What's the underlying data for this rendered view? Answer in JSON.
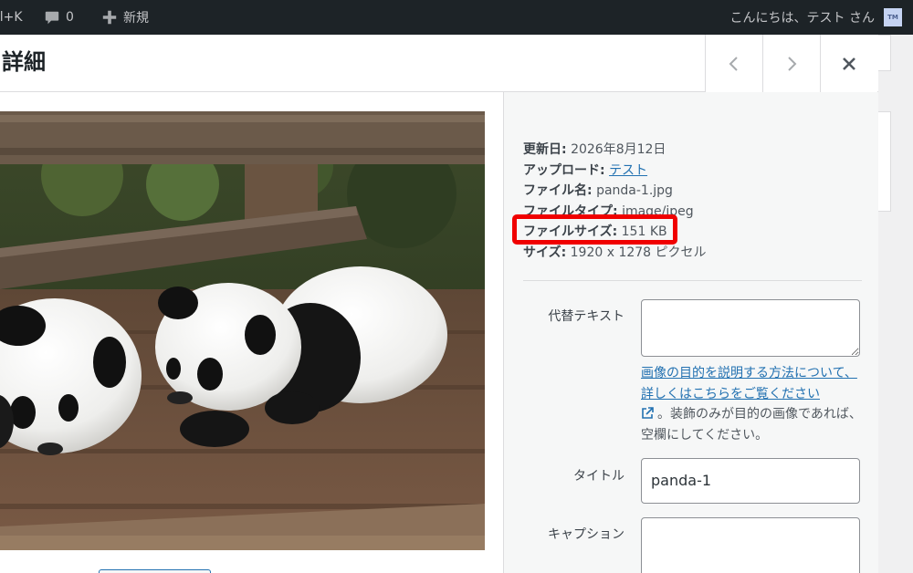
{
  "adminbar": {
    "shortcut": "rl+K",
    "comments_count": "0",
    "new_label": "新規",
    "greeting": "こんにちは、テスト さん",
    "avatar_text": "TM"
  },
  "modal": {
    "title": "詳細",
    "prev_icon": "chevron-left",
    "next_icon": "chevron-right",
    "close_icon": "close"
  },
  "details": {
    "uploaded_on_label": "更新日:",
    "uploaded_on": "2026年8月12日",
    "uploaded_by_label": "アップロード:",
    "uploaded_by": "テスト",
    "file_name_label": "ファイル名:",
    "file_name": "panda-1.jpg",
    "file_type_label": "ファイルタイプ:",
    "file_type": "image/jpeg",
    "file_size_label": "ファイルサイズ:",
    "file_size": "151 KB",
    "dimensions_label": "サイズ:",
    "dimensions": "1920 x 1278 ピクセル"
  },
  "fields": {
    "alt_label": "代替テキスト",
    "alt_value": "",
    "alt_help_link": "画像の目的を説明する方法について、詳しくはこちらをご覧ください",
    "alt_help_text": "。装飾のみが目的の画像であれば、空欄にしてください。",
    "title_label": "タイトル",
    "title_value": "panda-1",
    "caption_label": "キャプション",
    "caption_value": ""
  },
  "colors": {
    "highlight": "#f00000",
    "link": "#2271b1"
  }
}
